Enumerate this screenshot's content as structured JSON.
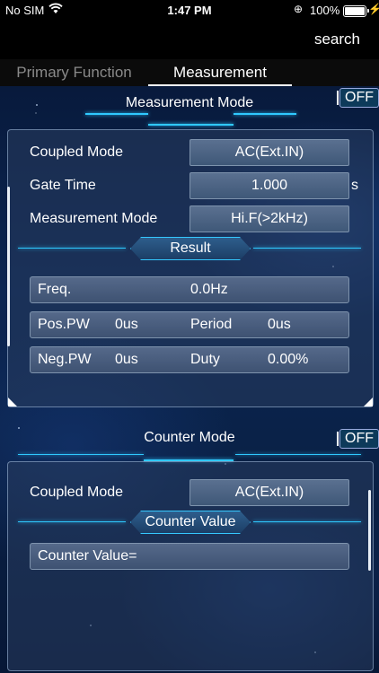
{
  "status": {
    "carrier": "No SIM",
    "time": "1:47 PM",
    "battery_pct": "100%"
  },
  "nav": {
    "search": "search"
  },
  "tabs": [
    {
      "label": "Primary Function"
    },
    {
      "label": "Measurement"
    }
  ],
  "measurement_mode": {
    "title": "Measurement Mode",
    "toggle": "OFF",
    "coupled_label": "Coupled Mode",
    "coupled_value": "AC(Ext.IN)",
    "gate_label": "Gate Time",
    "gate_value": "1.000",
    "gate_unit": "s",
    "mode_label": "Measurement Mode",
    "mode_value": "Hi.F(>2kHz)",
    "result_title": "Result",
    "freq_label": "Freq.",
    "freq_value": "0.0Hz",
    "pospw_label": "Pos.PW",
    "pospw_value": "0us",
    "period_label": "Period",
    "period_value": "0us",
    "negpw_label": "Neg.PW",
    "negpw_value": "0us",
    "duty_label": "Duty",
    "duty_value": "0.00%"
  },
  "counter_mode": {
    "title": "Counter Mode",
    "toggle": "OFF",
    "coupled_label": "Coupled Mode",
    "coupled_value": "AC(Ext.IN)",
    "counter_value_title": "Counter Value",
    "counter_value_label": "Counter Value="
  },
  "colors": {
    "accent": "#2fc9ff",
    "background": "#0b2552",
    "field": "#4a6282"
  }
}
